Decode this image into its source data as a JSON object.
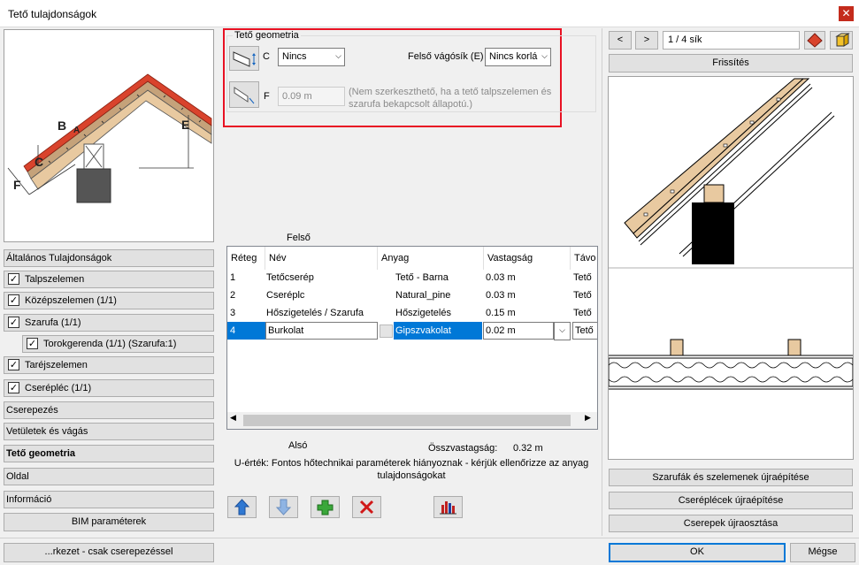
{
  "window": {
    "title": "Tető tulajdonságok",
    "close_glyph": "✕"
  },
  "sidebar": {
    "general": "Általános Tulajdonságok",
    "items": [
      {
        "label": "Talpszelemen",
        "checked": true
      },
      {
        "label": "Középszelemen (1/1)",
        "checked": true
      },
      {
        "label": "Szarufa (1/1)",
        "checked": true
      },
      {
        "label": "Torokgerenda (1/1) (Szarufa:1)",
        "checked": true
      },
      {
        "label": "Taréjszelemen",
        "checked": true
      },
      {
        "label": "Cserépléc (1/1)",
        "checked": true
      }
    ],
    "categories": [
      "Cserepezés",
      "Vetületek és vágás",
      "Tető geometria",
      "Oldal",
      "Információ"
    ],
    "bim_button": "BIM paraméterek",
    "bottom_button": "...rkezet - csak cserepezéssel"
  },
  "preview": {
    "labels": [
      "B",
      "A",
      "E",
      "C",
      "F"
    ]
  },
  "geometry": {
    "legend": "Tető geometria",
    "c_label": "C",
    "c_value": "Nincs",
    "top_cut_label": "Felső vágósík (E)",
    "top_cut_value": "Nincs korlá",
    "f_label": "F",
    "f_value": "0.09 m",
    "f_note": "(Nem szerkeszthető, ha a tető talpszelemen és szarufa bekapcsolt állapotú.)"
  },
  "layers": {
    "top_label": "Felső",
    "bottom_label": "Alsó",
    "columns": [
      "Réteg",
      "Név",
      "Anyag",
      "Vastagság",
      "Távo"
    ],
    "rows": [
      {
        "layer": "1",
        "name": "Tetőcserép",
        "material": "Tető - Barna",
        "thickness": "0.03 m",
        "dist": "Tető"
      },
      {
        "layer": "2",
        "name": "Cseréplc",
        "material": "Natural_pine",
        "thickness": "0.03 m",
        "dist": "Tető"
      },
      {
        "layer": "3",
        "name": "Hőszigetelés / Szarufa",
        "material": "Hőszigetelés",
        "thickness": "0.15 m",
        "dist": "Tető"
      },
      {
        "layer": "4",
        "name": "Burkolat",
        "material": "Gipszvakolat",
        "thickness": "0.02 m",
        "dist": "Tető"
      }
    ],
    "total_label": "Összvastagság:",
    "total_value": "0.32 m",
    "u_note": "U-érték: Fontos hőtechnikai paraméterek hiányoznak - kérjük ellenőrizze az anyag tulajdonságokat"
  },
  "right": {
    "prev": "<",
    "next": ">",
    "page": "1 / 4 sík",
    "refresh": "Frissítés",
    "rebuild_rafters": "Szarufák és szelemenek újraépítése",
    "rebuild_battens": "Cseréplécek újraépítése",
    "redistribute_tiles": "Cserepek újraosztása",
    "ok": "OK",
    "cancel": "Mégse"
  },
  "colors": {
    "highlight_border": "#e81123",
    "selection": "#0078d7",
    "roof_red": "#d9432c",
    "wood": "#e8c9a0"
  }
}
